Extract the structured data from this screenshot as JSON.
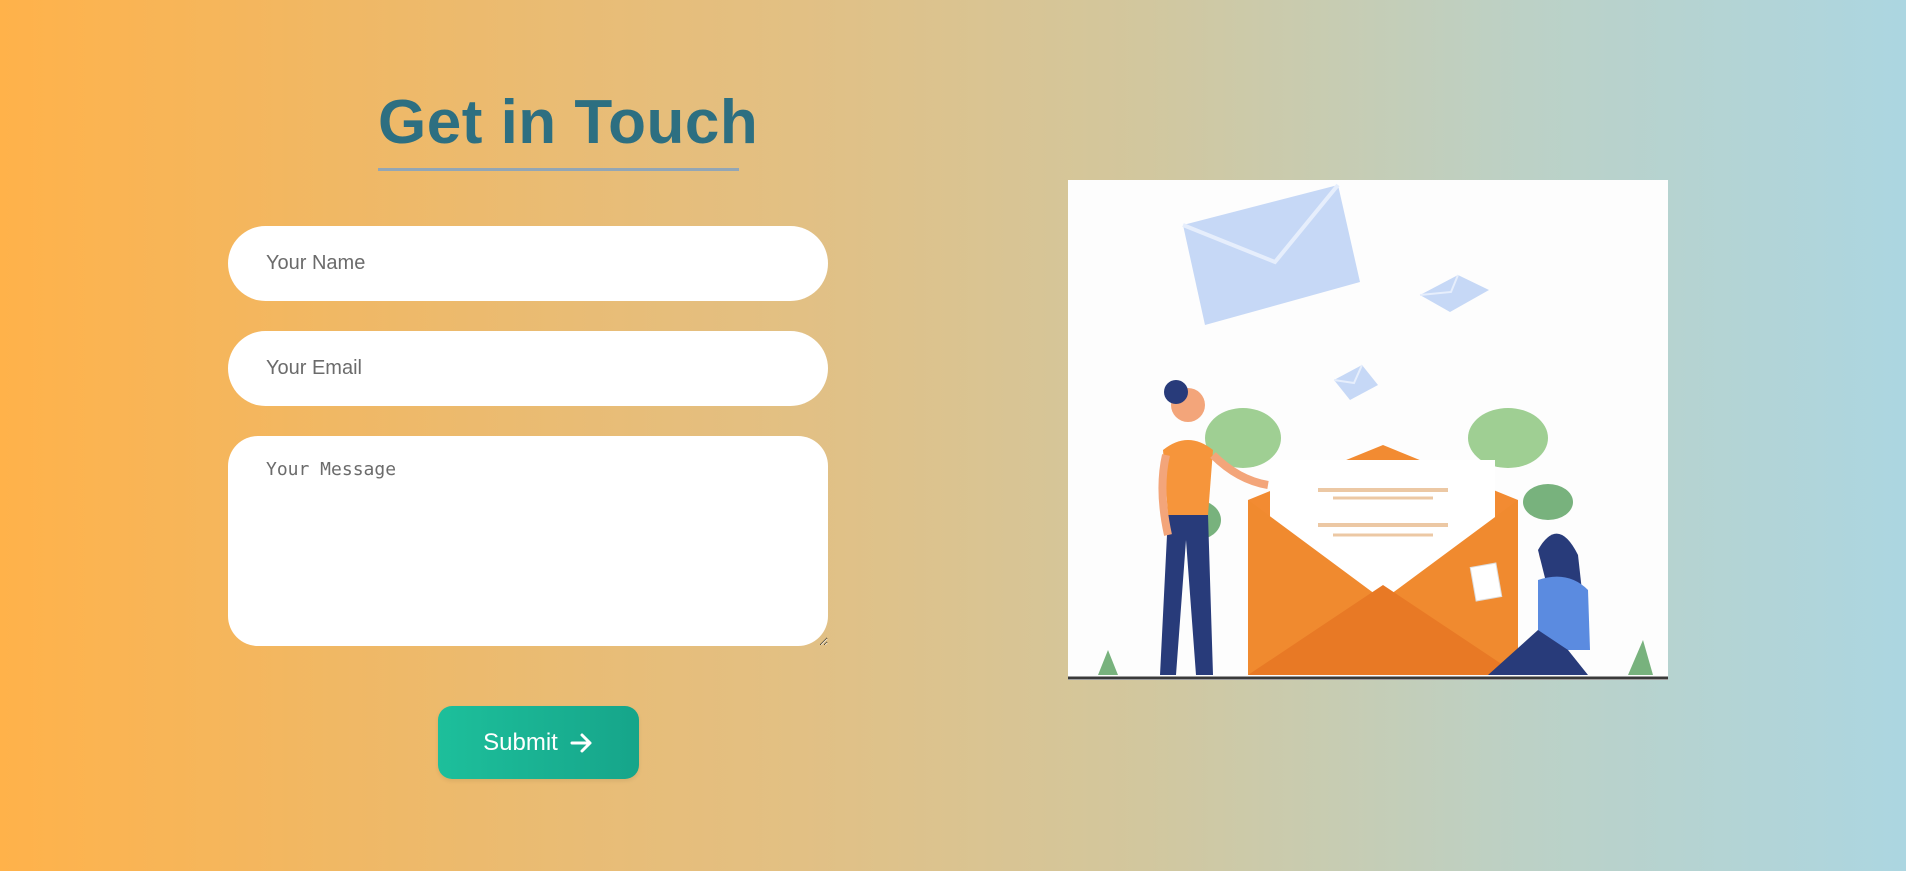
{
  "contact": {
    "title": "Get in Touch",
    "name_placeholder": "Your Name",
    "email_placeholder": "Your Email",
    "message_placeholder": "Your Message",
    "submit_label": "Submit",
    "submit_icon": "arrow-right-icon"
  },
  "illustration": {
    "description_icon": "contact-envelope-illustration"
  },
  "colors": {
    "title": "#2d6f81",
    "underline": "#93a6b5",
    "button": "#1dbf9b",
    "background_left": "#ffb24a",
    "background_right": "#acd6e1"
  }
}
